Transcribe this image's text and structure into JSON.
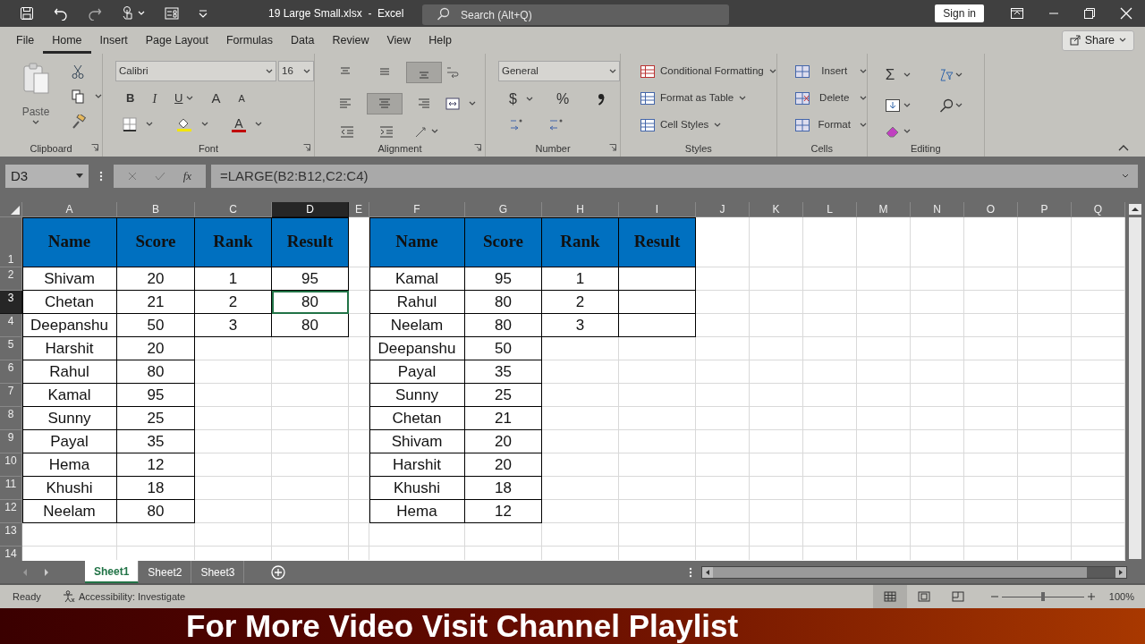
{
  "title_bar": {
    "document_title": "19 Large Small.xlsx  -  Excel",
    "search": {
      "placeholder": "Search (Alt+Q)"
    },
    "sign_in": "Sign in"
  },
  "menu_tabs": [
    {
      "label": "File",
      "selected": false
    },
    {
      "label": "Home",
      "selected": true
    },
    {
      "label": "Insert",
      "selected": false
    },
    {
      "label": "Page Layout",
      "selected": false
    },
    {
      "label": "Formulas",
      "selected": false
    },
    {
      "label": "Data",
      "selected": false
    },
    {
      "label": "Review",
      "selected": false
    },
    {
      "label": "View",
      "selected": false
    },
    {
      "label": "Help",
      "selected": false
    }
  ],
  "share": "Share",
  "ribbon": {
    "clipboard": {
      "paste": "Paste",
      "label": "Clipboard"
    },
    "font": {
      "font_name": "Calibri",
      "font_size": "16",
      "buttons": [
        {
          "kind": "bold",
          "label": "B"
        },
        {
          "kind": "italic",
          "label": "I"
        },
        {
          "kind": "underline",
          "label": "U"
        },
        {
          "kind": "grow",
          "label": "A"
        },
        {
          "kind": "shrink",
          "label": "A"
        }
      ],
      "font_color": "A",
      "label": "Font"
    },
    "alignment": {
      "buttons": [
        {
          "kind": "top",
          "selected": false
        },
        {
          "kind": "middle",
          "selected": false
        },
        {
          "kind": "bottom",
          "selected": true
        },
        {
          "kind": "left",
          "selected": false
        },
        {
          "kind": "center",
          "selected": true
        },
        {
          "kind": "right",
          "selected": false
        }
      ],
      "label": "Alignment"
    },
    "number": {
      "format": "General",
      "symbols": [
        "$",
        "%"
      ],
      "label": "Number"
    },
    "styles": {
      "commands": [
        "Conditional Formatting",
        "Format as Table",
        "Cell Styles"
      ],
      "label": "Styles"
    },
    "cells": {
      "commands": [
        "Insert",
        "Delete",
        "Format"
      ],
      "label": "Cells"
    },
    "editing": {
      "sum": "Σ",
      "label": "Editing"
    }
  },
  "formula_bar": {
    "name_box": "D3",
    "function_button": "fx",
    "formula": "=LARGE(B2:B12,C2:C4)"
  },
  "sheet": {
    "columns": [
      {
        "label": "A",
        "selected": false
      },
      {
        "label": "B",
        "selected": false
      },
      {
        "label": "C",
        "selected": false
      },
      {
        "label": "D",
        "selected": true
      },
      {
        "label": "E",
        "selected": false
      },
      {
        "label": "F",
        "selected": false
      },
      {
        "label": "G",
        "selected": false
      },
      {
        "label": "H",
        "selected": false
      },
      {
        "label": "I",
        "selected": false
      },
      {
        "label": "J",
        "selected": false
      },
      {
        "label": "K",
        "selected": false
      },
      {
        "label": "L",
        "selected": false
      },
      {
        "label": "M",
        "selected": false
      },
      {
        "label": "N",
        "selected": false
      },
      {
        "label": "O",
        "selected": false
      },
      {
        "label": "P",
        "selected": false
      },
      {
        "label": "Q",
        "selected": false
      }
    ],
    "rows": [
      {
        "number": "1",
        "selected": false,
        "kind": "header",
        "cells": {
          "A": {
            "text": "Name",
            "selected": false
          },
          "B": {
            "text": "Score",
            "selected": false
          },
          "C": {
            "text": "Rank",
            "selected": false
          },
          "D": {
            "text": "Result",
            "selected": false
          },
          "F": {
            "text": "Name",
            "selected": false
          },
          "G": {
            "text": "Score",
            "selected": false
          },
          "H": {
            "text": "Rank",
            "selected": false
          },
          "I": {
            "text": "Result",
            "selected": false
          }
        }
      },
      {
        "number": "2",
        "selected": false,
        "kind": "body",
        "cells": {
          "A": {
            "text": "Shivam",
            "selected": false
          },
          "B": {
            "text": "20",
            "selected": false
          },
          "C": {
            "text": "1",
            "selected": false
          },
          "D": {
            "text": "95",
            "selected": false
          },
          "F": {
            "text": "Kamal",
            "selected": false
          },
          "G": {
            "text": "95",
            "selected": false
          },
          "H": {
            "text": "1",
            "selected": false
          },
          "I": {
            "selected": false
          }
        }
      },
      {
        "number": "3",
        "selected": true,
        "kind": "body",
        "cells": {
          "A": {
            "text": "Chetan",
            "selected": false
          },
          "B": {
            "text": "21",
            "selected": false
          },
          "C": {
            "text": "2",
            "selected": false
          },
          "D": {
            "text": "80",
            "selected": true
          },
          "F": {
            "text": "Rahul",
            "selected": false
          },
          "G": {
            "text": "80",
            "selected": false
          },
          "H": {
            "text": "2",
            "selected": false
          },
          "I": {
            "selected": false
          }
        }
      },
      {
        "number": "4",
        "selected": false,
        "kind": "body",
        "cells": {
          "A": {
            "text": "Deepanshu",
            "selected": false
          },
          "B": {
            "text": "50",
            "selected": false
          },
          "C": {
            "text": "3",
            "selected": false
          },
          "D": {
            "text": "80",
            "selected": false
          },
          "F": {
            "text": "Neelam",
            "selected": false
          },
          "G": {
            "text": "80",
            "selected": false
          },
          "H": {
            "text": "3",
            "selected": false
          },
          "I": {
            "selected": false
          }
        }
      },
      {
        "number": "5",
        "selected": false,
        "kind": "body",
        "cells": {
          "A": {
            "text": "Harshit",
            "selected": false
          },
          "B": {
            "text": "20",
            "selected": false
          },
          "F": {
            "text": "Deepanshu",
            "selected": false
          },
          "G": {
            "text": "50",
            "selected": false
          }
        }
      },
      {
        "number": "6",
        "selected": false,
        "kind": "body",
        "cells": {
          "A": {
            "text": "Rahul",
            "selected": false
          },
          "B": {
            "text": "80",
            "selected": false
          },
          "F": {
            "text": "Payal",
            "selected": false
          },
          "G": {
            "text": "35",
            "selected": false
          }
        }
      },
      {
        "number": "7",
        "selected": false,
        "kind": "body",
        "cells": {
          "A": {
            "text": "Kamal",
            "selected": false
          },
          "B": {
            "text": "95",
            "selected": false
          },
          "F": {
            "text": "Sunny",
            "selected": false
          },
          "G": {
            "text": "25",
            "selected": false
          }
        }
      },
      {
        "number": "8",
        "selected": false,
        "kind": "body",
        "cells": {
          "A": {
            "text": "Sunny",
            "selected": false
          },
          "B": {
            "text": "25",
            "selected": false
          },
          "F": {
            "text": "Chetan",
            "selected": false
          },
          "G": {
            "text": "21",
            "selected": false
          }
        }
      },
      {
        "number": "9",
        "selected": false,
        "kind": "body",
        "cells": {
          "A": {
            "text": "Payal",
            "selected": false
          },
          "B": {
            "text": "35",
            "selected": false
          },
          "F": {
            "text": "Shivam",
            "selected": false
          },
          "G": {
            "text": "20",
            "selected": false
          }
        }
      },
      {
        "number": "10",
        "selected": false,
        "kind": "body",
        "cells": {
          "A": {
            "text": "Hema",
            "selected": false
          },
          "B": {
            "text": "12",
            "selected": false
          },
          "F": {
            "text": "Harshit",
            "selected": false
          },
          "G": {
            "text": "20",
            "selected": false
          }
        }
      },
      {
        "number": "11",
        "selected": false,
        "kind": "body",
        "cells": {
          "A": {
            "text": "Khushi",
            "selected": false
          },
          "B": {
            "text": "18",
            "selected": false
          },
          "F": {
            "text": "Khushi",
            "selected": false
          },
          "G": {
            "text": "18",
            "selected": false
          }
        }
      },
      {
        "number": "12",
        "selected": false,
        "kind": "body",
        "cells": {
          "A": {
            "text": "Neelam",
            "selected": false
          },
          "B": {
            "text": "80",
            "selected": false
          },
          "F": {
            "text": "Hema",
            "selected": false
          },
          "G": {
            "text": "12",
            "selected": false
          }
        }
      },
      {
        "number": "13",
        "selected": false,
        "kind": "body"
      },
      {
        "number": "14",
        "selected": false,
        "kind": "body"
      }
    ]
  },
  "sheet_tabs": [
    {
      "label": "Sheet1",
      "selected": true
    },
    {
      "label": "Sheet2",
      "selected": false
    },
    {
      "label": "Sheet3",
      "selected": false
    }
  ],
  "status_bar": {
    "mode": "Ready",
    "accessibility": "Accessibility: Investigate",
    "view_buttons": [
      {
        "kind": "normal",
        "selected": true
      },
      {
        "kind": "page_layout",
        "selected": false
      },
      {
        "kind": "page_break",
        "selected": false
      }
    ],
    "zoom_slider": {
      "level": 0.5
    },
    "zoom": "100%"
  },
  "banner": "For More Video Visit Channel Playlist"
}
